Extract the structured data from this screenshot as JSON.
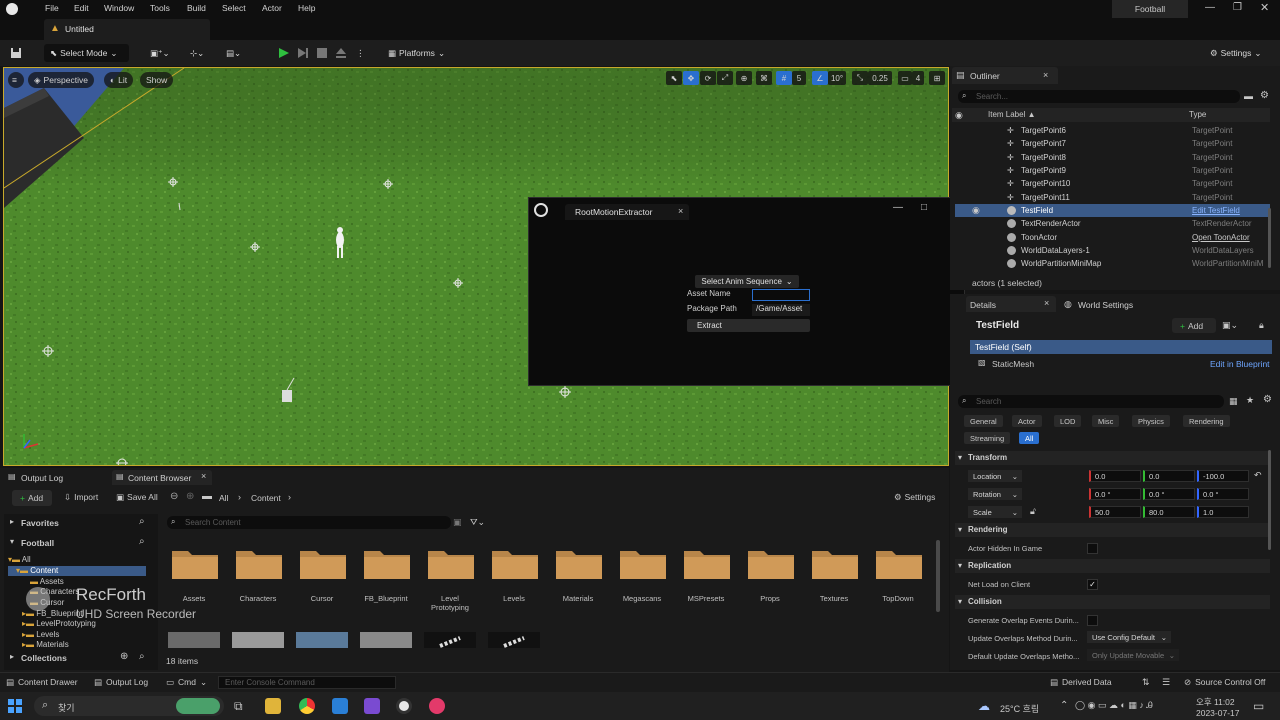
{
  "menubar": {
    "items": [
      "File",
      "Edit",
      "Window",
      "Tools",
      "Build",
      "Select",
      "Actor",
      "Help"
    ],
    "project_name": "Football"
  },
  "level_tab": {
    "label": "Untitled"
  },
  "toolbar": {
    "select_mode": "Select Mode",
    "platforms": "Platforms",
    "settings": "Settings"
  },
  "viewport": {
    "perspective": "Perspective",
    "lit": "Lit",
    "show": "Show",
    "grid_snap": "5",
    "rotation_snap": "10°",
    "scale_snap": "0.25",
    "camera_speed": "4"
  },
  "dialog": {
    "title": "RootMotionExtractor",
    "anim_dropdown": "Select Anim Sequence",
    "asset_name_label": "Asset Name",
    "asset_name_value": "",
    "package_path_label": "Package Path",
    "package_path_value": "/Game/Asset",
    "extract_button": "Extract"
  },
  "outliner": {
    "tab_label": "Outliner",
    "search_placeholder": "Search...",
    "col_label": "Item Label ▲",
    "col_type": "Type",
    "rows": [
      {
        "name": "TargetPoint6",
        "type": "TargetPoint"
      },
      {
        "name": "TargetPoint7",
        "type": "TargetPoint"
      },
      {
        "name": "TargetPoint8",
        "type": "TargetPoint"
      },
      {
        "name": "TargetPoint9",
        "type": "TargetPoint"
      },
      {
        "name": "TargetPoint10",
        "type": "TargetPoint"
      },
      {
        "name": "TargetPoint11",
        "type": "TargetPoint"
      },
      {
        "name": "TestField",
        "type": "Edit TestField"
      },
      {
        "name": "TextRenderActor",
        "type": "TextRenderActor"
      },
      {
        "name": "ToonActor",
        "type": "Open ToonActor"
      },
      {
        "name": "WorldDataLayers-1",
        "type": "WorldDataLayers"
      },
      {
        "name": "WorldPartitionMiniMap",
        "type": "WorldPartitionMiniM"
      }
    ],
    "footer": "actors (1 selected)"
  },
  "details": {
    "tab_label": "Details",
    "world_settings_tab": "World Settings",
    "actor_name": "TestField",
    "add_button": "Add",
    "self_label": "TestField (Self)",
    "component": "StaticMesh",
    "edit_blueprint": "Edit in Blueprint",
    "search_placeholder": "Search",
    "categories": [
      "General",
      "Actor",
      "LOD",
      "Misc",
      "Physics",
      "Rendering"
    ],
    "categories2": [
      "Streaming",
      "All"
    ],
    "transform_header": "Transform",
    "location_label": "Location",
    "location": [
      "0.0",
      "0.0",
      "-100.0"
    ],
    "rotation_label": "Rotation",
    "rotation": [
      "0.0 °",
      "0.0 °",
      "0.0 °"
    ],
    "scale_label": "Scale",
    "scale": [
      "50.0",
      "80.0",
      "1.0"
    ],
    "rendering_header": "Rendering",
    "actor_hidden_label": "Actor Hidden In Game",
    "replication_header": "Replication",
    "net_load_label": "Net Load on Client",
    "collision_header": "Collision",
    "gen_overlap_label": "Generate Overlap Events Durin...",
    "update_overlap_label": "Update Overlaps Method Durin...",
    "update_overlap_value": "Use Config Default",
    "default_update_label": "Default Update Overlaps Metho...",
    "default_update_value": "Only Update Movable"
  },
  "bottom_tabs": {
    "output_log": "Output Log",
    "content_browser": "Content Browser"
  },
  "content_browser": {
    "add": "Add",
    "import": "Import",
    "save_all": "Save All",
    "path_all": "All",
    "path_content": "Content",
    "settings": "Settings",
    "favorites": "Favorites",
    "project": "Football",
    "tree": [
      "All",
      "Content",
      "Assets",
      "Characters",
      "Cursor",
      "FB_Blueprint",
      "LevelPrototyping",
      "Levels",
      "Materials"
    ],
    "collections": "Collections",
    "search_placeholder": "Search Content",
    "folders": [
      "Assets",
      "Characters",
      "Cursor",
      "FB_Blueprint",
      "Level\nPrototyping",
      "Levels",
      "Materials",
      "Megascans",
      "MSPresets",
      "Props",
      "Textures",
      "TopDown"
    ],
    "item_count": "18 items",
    "watermark_title": "RecForth",
    "watermark_sub": "UHD Screen Recorder"
  },
  "statusbar": {
    "content_drawer": "Content Drawer",
    "output_log": "Output Log",
    "cmd": "Cmd",
    "console_placeholder": "Enter Console Command",
    "derived_data": "Derived Data",
    "source_control": "Source Control Off"
  },
  "taskbar": {
    "search": "찾기",
    "weather": "25°C 흐림",
    "time": "오후 11:02",
    "date": "2023-07-17"
  },
  "colors": {
    "accent_blue": "#2a6fcf",
    "selection": "#3a5a88",
    "viewport_border": "#c8a92b",
    "grass": "#4e8a2c",
    "play_green": "#2fbf3f"
  }
}
